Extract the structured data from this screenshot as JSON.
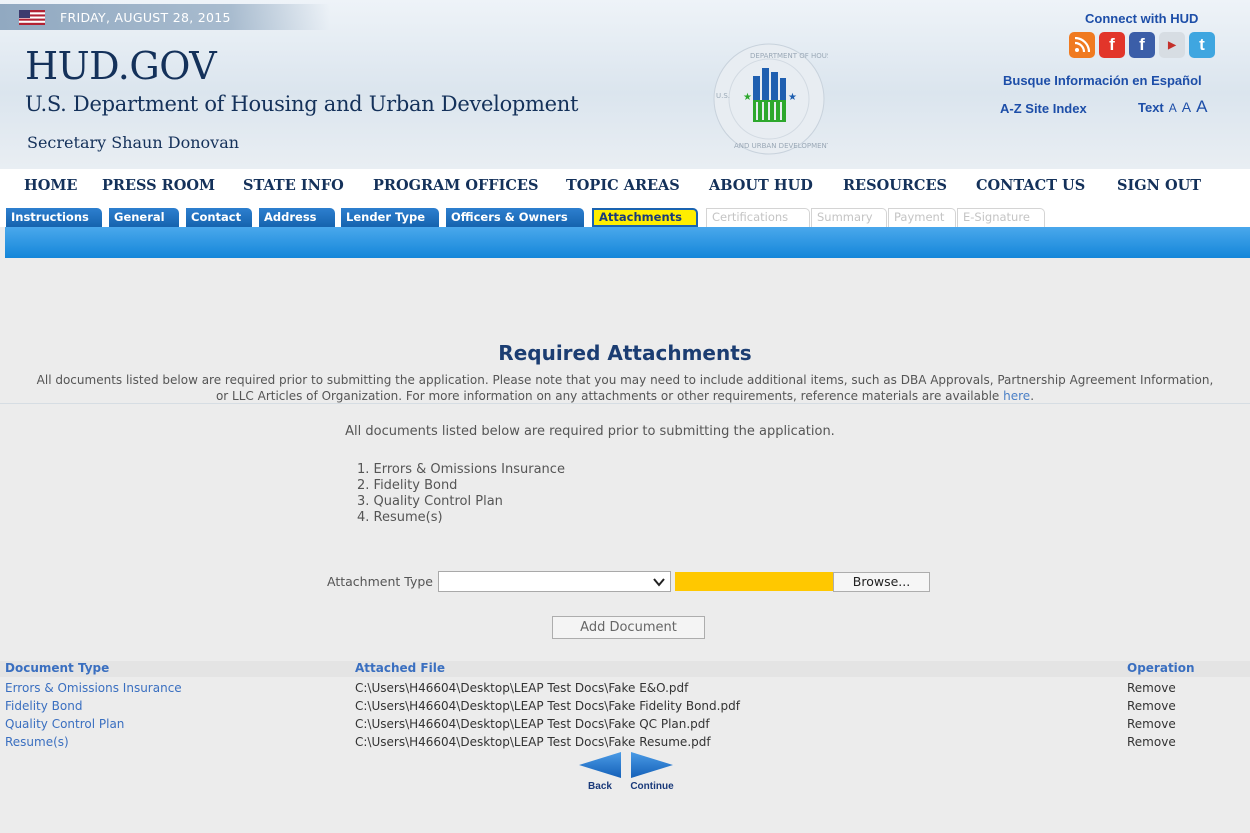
{
  "header": {
    "date": "FRIDAY, AUGUST 28, 2015",
    "site_title": "HUD.GOV",
    "department": "U.S. Department of Housing and Urban Development",
    "secretary": "Secretary Shaun Donovan",
    "seal_text_top": "DEPARTMENT OF HOUSING",
    "seal_text_bottom": "AND URBAN DEVELOPMENT",
    "seal_text_left": "U.S.",
    "connect_title": "Connect with HUD",
    "social_icons": [
      "rss-icon",
      "facebook-icon",
      "facebook-icon",
      "youtube-icon",
      "twitter-icon"
    ],
    "espanol_link": "Busque Información en Español",
    "az_index": "A-Z Site Index",
    "text_size_label": "Text",
    "text_size_options": [
      "A",
      "A",
      "A"
    ]
  },
  "nav": {
    "items": [
      "HOME",
      "PRESS ROOM",
      "STATE INFO",
      "PROGRAM OFFICES",
      "TOPIC AREAS",
      "ABOUT HUD",
      "RESOURCES",
      "CONTACT US",
      "SIGN OUT"
    ]
  },
  "tabs": {
    "items": [
      "Instructions",
      "General",
      "Contact",
      "Address",
      "Lender Type",
      "Officers & Owners",
      "Attachments",
      "Certifications",
      "Summary",
      "Payment",
      "E-Signature"
    ],
    "active": "Attachments",
    "disabled": [
      "Certifications",
      "Summary",
      "Payment",
      "E-Signature"
    ]
  },
  "main": {
    "heading": "Required Attachments",
    "intro_line1": "All documents listed below are required prior to submitting the application. Please note that you may need to include additional items, such as DBA Approvals, Partnership Agreement Information,",
    "intro_line2": "or LLC Articles of Organization. For more information on any attachments or other requirements, reference materials are available",
    "intro_link": "here",
    "intro_end": ".",
    "required_note": "All documents listed below are required prior to submitting the application.",
    "required_list": [
      "1.  Errors & Omissions Insurance",
      "2.  Fidelity Bond",
      "3.  Quality Control Plan",
      "4.  Resume(s)"
    ],
    "attachment_type_label": "Attachment Type",
    "attachment_type_value": "",
    "browse_label": "Browse...",
    "add_document_label": "Add Document"
  },
  "table": {
    "headers": [
      "Document Type",
      "Attached File",
      "Operation"
    ],
    "rows": [
      {
        "type": "Errors & Omissions Insurance",
        "file": "C:\\Users\\H46604\\Desktop\\LEAP Test Docs\\Fake E&O.pdf",
        "op": "Remove"
      },
      {
        "type": "Fidelity Bond",
        "file": "C:\\Users\\H46604\\Desktop\\LEAP Test Docs\\Fake Fidelity Bond.pdf",
        "op": "Remove"
      },
      {
        "type": "Quality Control Plan",
        "file": "C:\\Users\\H46604\\Desktop\\LEAP Test Docs\\Fake QC Plan.pdf",
        "op": "Remove"
      },
      {
        "type": "Resume(s)",
        "file": "C:\\Users\\H46604\\Desktop\\LEAP Test Docs\\Fake Resume.pdf",
        "op": "Remove"
      }
    ]
  },
  "footer_nav": {
    "back_label": "Back",
    "continue_label": "Continue"
  },
  "colors": {
    "brand_navy": "#14315a",
    "link_blue": "#1d4ea8",
    "tab_blue": "#1a6fc0",
    "tab_active": "#ffee00",
    "file_box": "#ffc800",
    "band_blue": "#1486d9"
  }
}
